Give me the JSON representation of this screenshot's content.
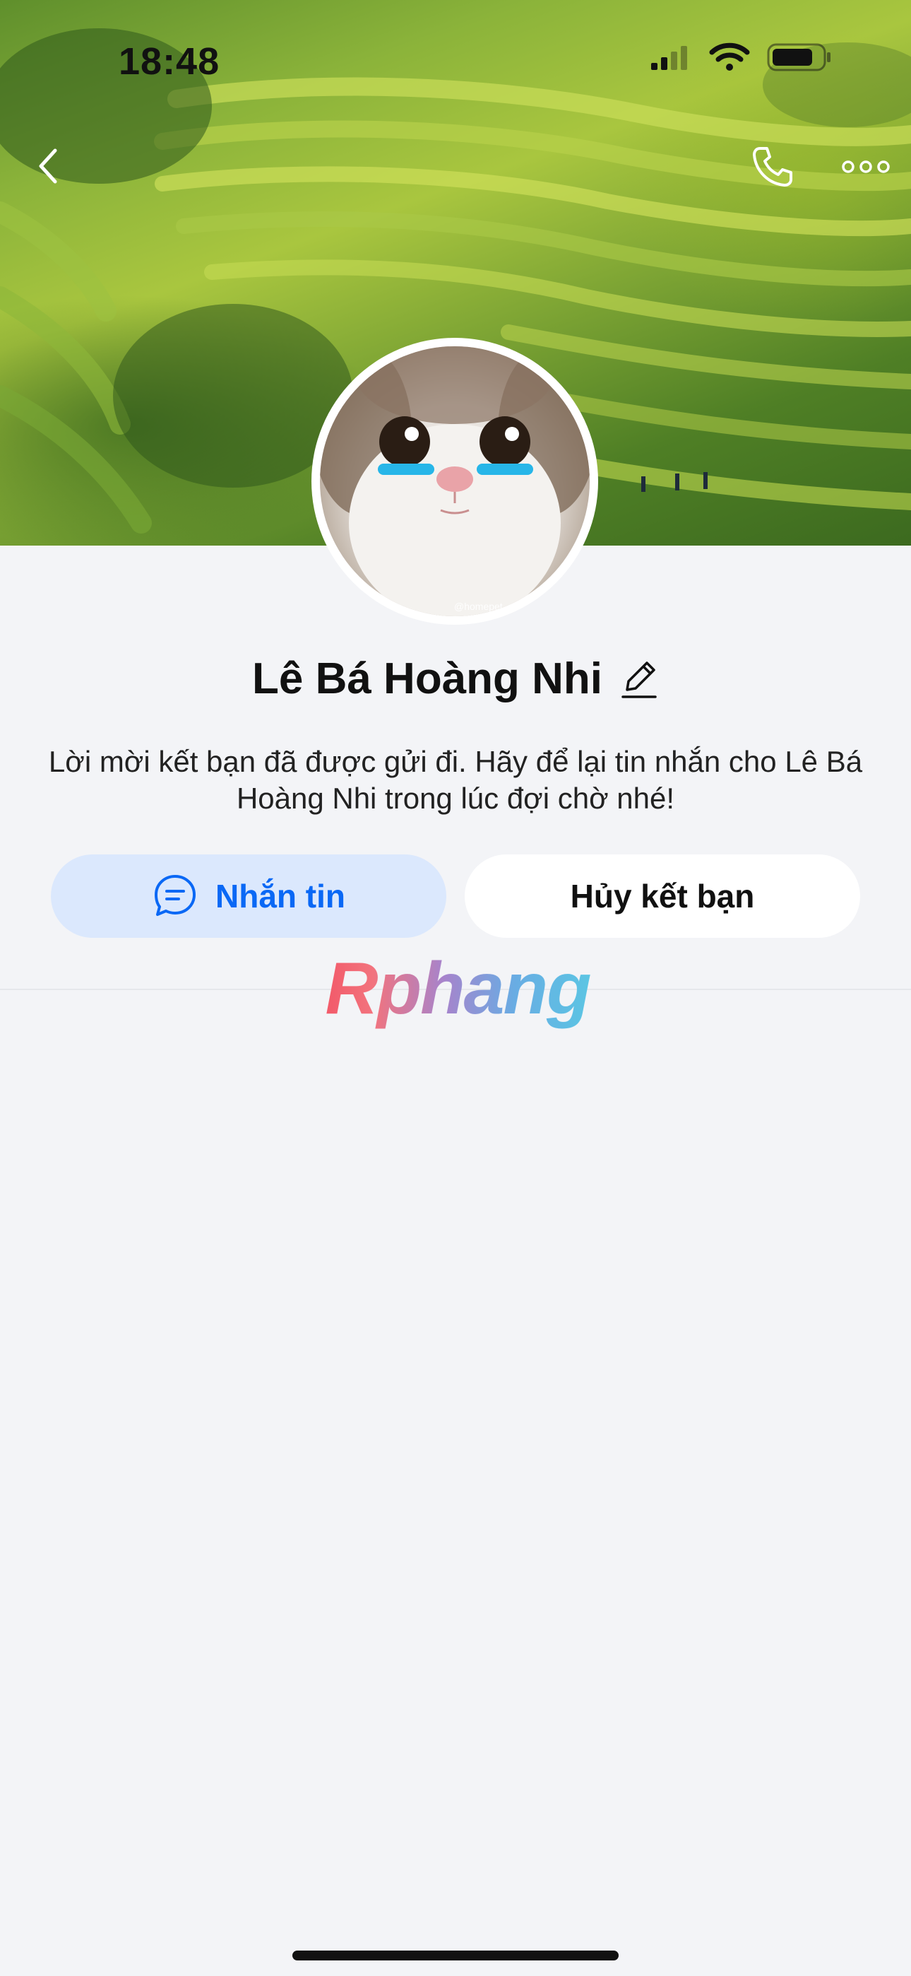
{
  "status_bar": {
    "time": "18:48",
    "icons": [
      "cellular-signal-icon",
      "wifi-icon",
      "battery-icon"
    ]
  },
  "nav": {
    "back_icon": "chevron-left-icon",
    "call_icon": "phone-icon",
    "more_icon": "more-horizontal-icon"
  },
  "profile": {
    "name": "Lê Bá Hoàng Nhi",
    "edit_icon": "pencil-icon",
    "avatar_watermark": "@homepet",
    "invite_message": "Lời mời kết bạn đã được gửi đi. Hãy để lại tin nhắn cho Lê Bá Hoàng Nhi trong lúc đợi chờ nhé!"
  },
  "actions": {
    "message_label": "Nhắn tin",
    "message_icon": "chat-bubble-icon",
    "cancel_label": "Hủy kết bạn"
  },
  "watermark_text": "Rphang",
  "colors": {
    "accent": "#0a68f5",
    "accent_bg": "#dbe8fd",
    "page_bg": "#f3f4f7"
  }
}
